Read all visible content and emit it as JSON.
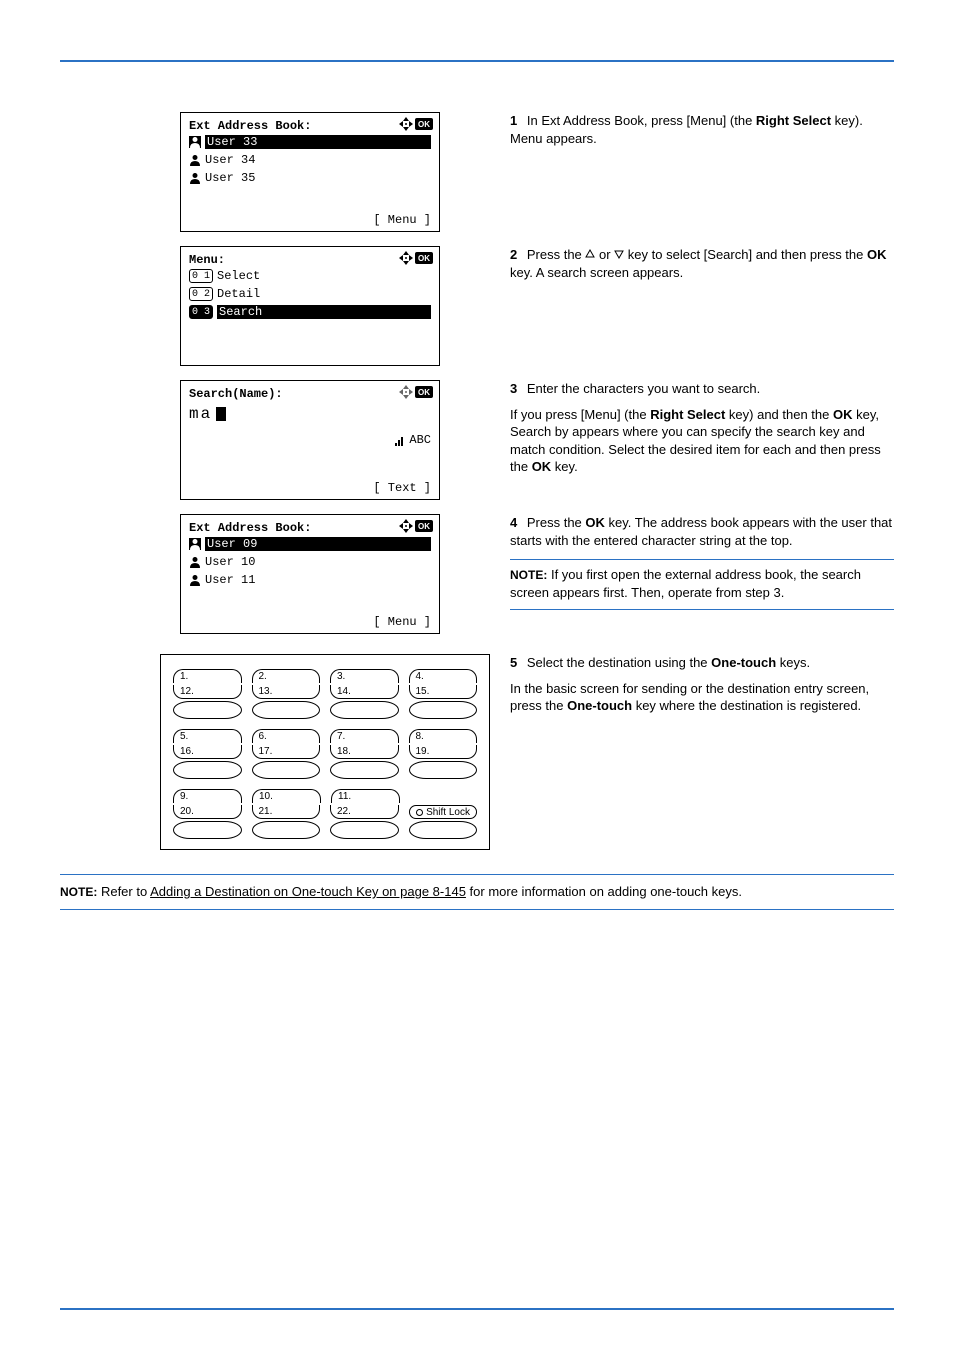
{
  "lcd1": {
    "title": "Ext Address Book:",
    "glyph": "a b",
    "line1": "User 33",
    "line2": "User 34",
    "line3": "User 35",
    "menu": "[ Menu ]"
  },
  "lcd2": {
    "title": "Menu:",
    "glyph": "a b",
    "line1": "Select",
    "line2": "Detail",
    "line3": "Search"
  },
  "lcd3": {
    "title": "Search(Name):",
    "glyph": "a b",
    "cursor": "ma*",
    "signal": "S",
    "abc": " ABC",
    "text": "[ Text ]"
  },
  "lcd4": {
    "title": "Ext Address Book:",
    "glyph": "a b",
    "line1": "User 09",
    "line2": "User 10",
    "line3": "User 11",
    "menu": "[ Menu ]"
  },
  "step1": {
    "num": "1",
    "text_a": "In Ext Address Book, press [Menu] (the ",
    "key": "Right Select",
    "text_b": " key). Menu appears."
  },
  "step2": {
    "num": "2",
    "text_a": "Press the ",
    "text_b": " or ",
    "text_c": " key to select [Search] and then press the ",
    "key": "OK",
    "text_d": " key. A search screen appears."
  },
  "step3": {
    "num": "3",
    "text_a": "Enter the characters you want to search.",
    "p2_a": "If you press [Menu] (the ",
    "p2_key1": "Right Select",
    "p2_b": " key) and then the ",
    "p2_key2": "OK",
    "p2_c": " key, Search by appears where you can specify the search key and match condition. Select the desired item for each and then press the ",
    "p2_key3": "OK",
    "p2_d": " key."
  },
  "step4": {
    "num": "4",
    "text_a": "Press the ",
    "key": "OK",
    "text_b": " key. The address book appears with the user that starts with the entered character string at the top."
  },
  "note1": {
    "label": "NOTE:",
    "text": " If you first open the external address book, the search screen appears first. Then, operate from step 3."
  },
  "step5": {
    "num": "5",
    "text_a": "Select the destination using the ",
    "key": "One-touch",
    "text_b": " keys.",
    "p2_a": "In the basic screen for sending or the destination entry screen, press the ",
    "p2_key": "One-touch",
    "p2_b": " key where the destination is registered."
  },
  "ot": {
    "r1t": [
      "1.",
      "2.",
      "3.",
      "4."
    ],
    "r1b": [
      "12.",
      "13.",
      "14.",
      "15."
    ],
    "r2t": [
      "5.",
      "6.",
      "7.",
      "8."
    ],
    "r2b": [
      "16.",
      "17.",
      "18.",
      "19."
    ],
    "r3t": [
      "9.",
      "10.",
      "11.",
      ""
    ],
    "r3b": [
      "20.",
      "21.",
      "22.",
      ""
    ],
    "shift": "Shift Lock"
  },
  "note2": {
    "label": "NOTE:",
    "text_a": " Refer to ",
    "link": "Adding a Destination on One-touch Key on page 8-145",
    "text_b": " for more information on adding one-touch keys."
  }
}
